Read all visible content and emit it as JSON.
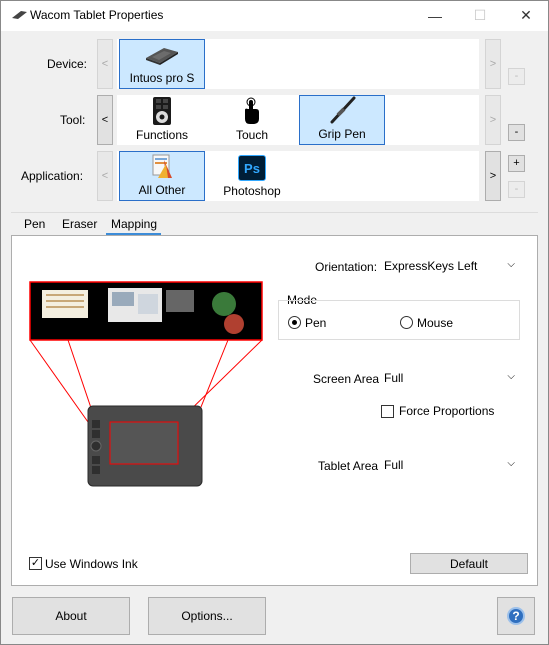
{
  "window": {
    "title": "Wacom Tablet Properties",
    "minimize_glyph": "—",
    "maximize_glyph": "☐",
    "close_glyph": "✕"
  },
  "device_row": {
    "label": "Device:",
    "tiles": [
      {
        "label": "Intuos pro S",
        "icon": "tablet-icon",
        "selected": true
      }
    ]
  },
  "tool_row": {
    "label": "Tool:",
    "tiles": [
      {
        "label": "Functions",
        "icon": "functions-icon",
        "selected": false
      },
      {
        "label": "Touch",
        "icon": "touch-hand-icon",
        "selected": false
      },
      {
        "label": "Grip Pen",
        "icon": "pen-icon",
        "selected": true
      }
    ]
  },
  "application_row": {
    "label": "Application:",
    "tiles": [
      {
        "label": "All Other",
        "icon": "all-other-apps-icon",
        "selected": true
      },
      {
        "label": "Photoshop",
        "icon": "photoshop-icon",
        "icon_text": "Ps",
        "selected": false
      }
    ]
  },
  "arrows": {
    "left": "<",
    "right": ">"
  },
  "pm": {
    "plus": "+",
    "minus": "-"
  },
  "tabs": [
    "Pen",
    "Eraser",
    "Mapping"
  ],
  "active_tab": "Mapping",
  "mapping": {
    "orientation_label": "Orientation:",
    "orientation_value": "ExpressKeys Left",
    "mode_label": "Mode",
    "mode_options": [
      "Pen",
      "Mouse"
    ],
    "mode_selected": "Pen",
    "screen_area_label": "Screen Area:",
    "screen_area_value": "Full",
    "force_proportions_label": "Force Proportions",
    "force_proportions_checked": false,
    "tablet_area_label": "Tablet Area:",
    "tablet_area_value": "Full",
    "use_windows_ink_label": "Use Windows Ink",
    "use_windows_ink_checked": true,
    "default_button": "Default",
    "chevron": "⌵",
    "check_glyph": "✓"
  },
  "footer": {
    "about_button": "About",
    "options_button": "Options...",
    "help_glyph": "?"
  },
  "colors": {
    "selection_bg": "#cce8ff",
    "selection_border": "#2a6fc9",
    "map_lines": "#ff0000",
    "photoshop_bg": "#001e36",
    "photoshop_fg": "#31a8ff",
    "help_blue": "#2f6fbf",
    "tab_underline": "#3c8cd8"
  }
}
